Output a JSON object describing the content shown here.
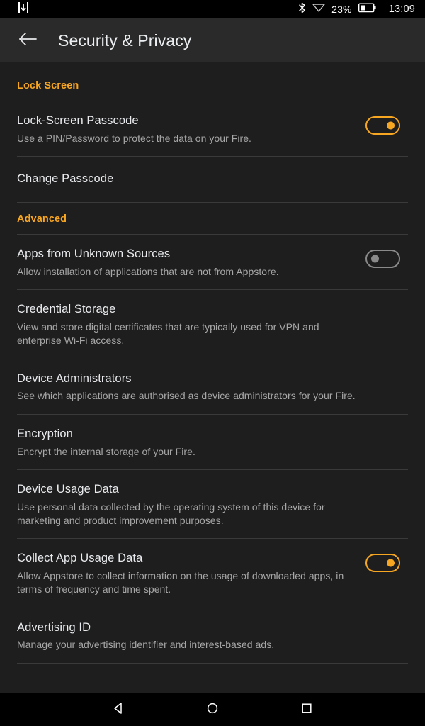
{
  "status_bar": {
    "download_icon": "download-icon",
    "bluetooth_icon": "bluetooth-icon",
    "wifi_icon": "wifi-icon",
    "battery_percent": "23%",
    "battery_icon": "battery-icon",
    "clock": "13:09"
  },
  "app_bar": {
    "back_icon": "back-arrow-icon",
    "title": "Security & Privacy"
  },
  "colors": {
    "accent": "#f7a622",
    "background": "#1e1e1e",
    "app_bar": "#2a2a2a",
    "divider": "#3a3a3a",
    "title_text": "#e8eaed",
    "subtitle_text": "#a7a7a7",
    "toggle_off": "#8a8a8a"
  },
  "sections": [
    {
      "header": "Lock Screen",
      "rows": [
        {
          "title": "Lock-Screen Passcode",
          "subtitle": "Use a PIN/Password to protect the data on your Fire.",
          "control": "toggle",
          "state": "on"
        },
        {
          "title": "Change Passcode",
          "subtitle": "",
          "control": "none",
          "state": ""
        }
      ]
    },
    {
      "header": "Advanced",
      "rows": [
        {
          "title": "Apps from Unknown Sources",
          "subtitle": "Allow installation of applications that are not from Appstore.",
          "control": "toggle",
          "state": "off"
        },
        {
          "title": "Credential Storage",
          "subtitle": "View and store digital certificates that are typically used for VPN and enterprise Wi-Fi access.",
          "control": "none",
          "state": ""
        },
        {
          "title": "Device Administrators",
          "subtitle": "See which applications are authorised as device administrators for your Fire.",
          "control": "none",
          "state": ""
        },
        {
          "title": "Encryption",
          "subtitle": "Encrypt the internal storage of your Fire.",
          "control": "none",
          "state": ""
        },
        {
          "title": "Device Usage Data",
          "subtitle": "Use personal data collected by the operating system of this device for marketing and product improvement purposes.",
          "control": "none",
          "state": ""
        },
        {
          "title": "Collect App Usage Data",
          "subtitle": "Allow Appstore to collect information on the usage of downloaded apps, in terms of frequency and time spent.",
          "control": "toggle",
          "state": "on"
        },
        {
          "title": "Advertising ID",
          "subtitle": "Manage your advertising identifier and interest-based ads.",
          "control": "none",
          "state": ""
        }
      ]
    }
  ],
  "nav_bar": {
    "back": "nav-back-icon",
    "home": "nav-home-icon",
    "recents": "nav-recents-icon"
  }
}
